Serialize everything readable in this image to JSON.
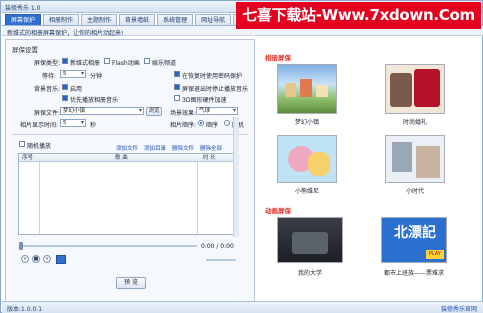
{
  "app": {
    "title": "装修秀乐 1.0",
    "version_label": "版本:1.0.0.1",
    "status_link": "装修秀乐官网"
  },
  "watermark": "七喜下载站-Www.7xdown.Com",
  "tabs": [
    "屏幕保护",
    "相册制作",
    "主题制作",
    "背景墙纸",
    "系统管理",
    "网址导航",
    "应用"
  ],
  "subtitle": "新维式的相册屏幕保护，让你的相片动起来!",
  "settings": {
    "title": "屏保设置",
    "type_label": "屏保类型:",
    "type_options": [
      {
        "label": "新维式相册",
        "checked": true
      },
      {
        "label": "Flash动画",
        "checked": false
      },
      {
        "label": "娱乐频道",
        "checked": false
      }
    ],
    "wait_label": "等待:",
    "wait_value": "5",
    "wait_unit": "分钟",
    "password_label": "在恢复时使用密码保护",
    "music_label": "背景音乐:",
    "music_enable": "启用",
    "music_priority": "优先播放相册音乐",
    "music_stop_label": "屏保退出时停止播放音乐",
    "use3d_label": "3D图形硬件加速",
    "file_label": "屏保文件:",
    "file_value": "梦幻小镇",
    "browse": "浏览",
    "effect_label": "场景效果:",
    "effect_value": "气球",
    "interval_label": "相片显示时间:",
    "interval_value": "5",
    "interval_unit": "秒",
    "order_label": "相片顺序:",
    "order_options": [
      {
        "label": "顺序",
        "checked": true
      },
      {
        "label": "随机",
        "checked": false
      }
    ]
  },
  "playlist": {
    "random_label": "随机播放",
    "actions": [
      "添加文件",
      "添加目录",
      "删除文件",
      "删除全部"
    ],
    "columns": [
      "序号",
      "歌 曲",
      "时 长"
    ],
    "time": "0:00 / 0:00",
    "controls": [
      "prev-icon",
      "stop-icon",
      "next-icon",
      "play-icon"
    ],
    "preview_button": "预 览"
  },
  "right": {
    "album_header": "相册屏保",
    "album_items": [
      "梦幻小镇",
      "时尚婚礼",
      "小熊维尼",
      "小时代"
    ],
    "anim_header": "动画屏保",
    "anim_items": [
      "我的大学",
      "都市上班族——票难求"
    ],
    "anim_thumb_text": "北漂記",
    "anim_thumb_sub": "PLAY"
  }
}
